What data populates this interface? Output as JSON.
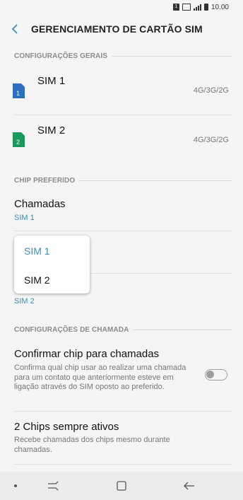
{
  "status_bar": {
    "time": "10.00",
    "sim_badge": "1"
  },
  "header": {
    "title": "GERENCIAMENTO DE CARTÃO SIM",
    "back_icon": "back-arrow-icon"
  },
  "sections": {
    "general": "CONFIGURAÇÕES GERAIS",
    "preferred": "CHIP PREFERIDO",
    "call_settings": "CONFIGURAÇÕES DE CHAMADA"
  },
  "sims": [
    {
      "name": "SIM 1",
      "network": "4G/3G/2G",
      "badge": "1",
      "color": "#2c6fbf"
    },
    {
      "name": "SIM 2",
      "network": "4G/3G/2G",
      "badge": "2",
      "color": "#1a9a5a"
    }
  ],
  "preferred": {
    "calls_label": "Chamadas",
    "calls_value": "SIM 1",
    "hidden_item_value": "SIM 2"
  },
  "dropdown": {
    "options": [
      "SIM 1",
      "SIM 2"
    ],
    "selected_color": "#3b8fb8"
  },
  "call_settings": {
    "confirm_title": "Confirmar chip para chamadas",
    "confirm_desc": "Confirma qual chip usar ao realizar uma chamada para um contato que anteriormente esteve em ligação através do SIM oposto ao preferido.",
    "confirm_toggle_on": false,
    "dual_title": "2 Chips sempre ativos",
    "dual_desc": "Recebe chamadas dos chips mesmo durante chamadas."
  }
}
